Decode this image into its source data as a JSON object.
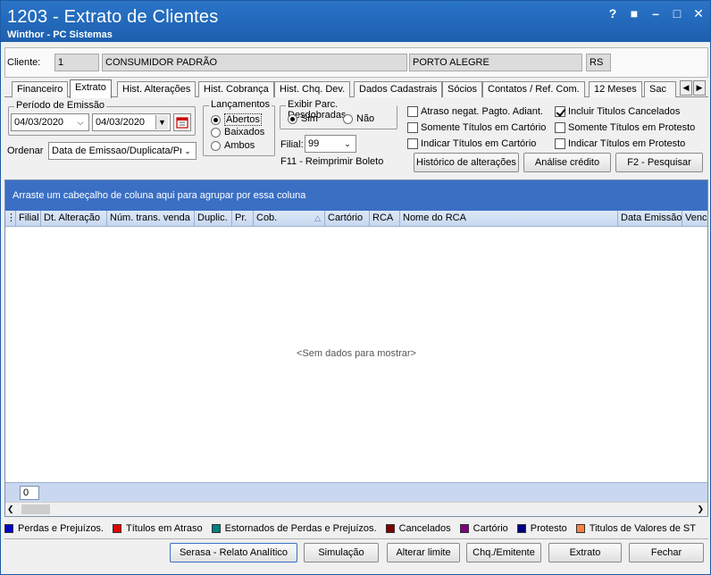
{
  "window": {
    "title": "1203 - Extrato de Clientes",
    "subtitle": "Winthor - PC Sistemas",
    "controls": [
      "?",
      "■",
      "–",
      "□",
      "✕"
    ]
  },
  "client": {
    "label": "Cliente:",
    "code": "1",
    "name": "CONSUMIDOR PADRÃO",
    "city": "PORTO ALEGRE",
    "state": "RS"
  },
  "tabs": [
    "Financeiro",
    "Extrato",
    "Hist. Alterações",
    "Hist. Cobrança",
    "Hist. Chq. Dev.",
    "Dados Cadastrais",
    "Sócios",
    "Contatos / Ref. Com.",
    "12 Meses",
    "Sac"
  ],
  "active_tab": "Extrato",
  "periodo": {
    "legend": "Período de Emissão",
    "start": "04/03/2020",
    "end": "04/03/2020"
  },
  "ordenar": {
    "label": "Ordenar",
    "value": "Data de Emissao/Duplicata/Pre"
  },
  "lancamentos": {
    "legend": "Lançamentos",
    "options": [
      "Abertos",
      "Baixados",
      "Ambos"
    ],
    "selected": "Abertos"
  },
  "exibir": {
    "legend": "Exibir Parc. Desdobradas",
    "options": [
      "Sim",
      "Não"
    ],
    "selected": "Sim"
  },
  "filial": {
    "label": "Filial:",
    "value": "99"
  },
  "f11": "F11 - Reimprimir Boleto",
  "checks": [
    {
      "label": "Atraso negat. Pagto. Adiant.",
      "checked": false
    },
    {
      "label": "Somente Títulos em Cartório",
      "checked": false
    },
    {
      "label": "Indicar Títulos em Cartório",
      "checked": false
    },
    {
      "label": "Incluir Titulos Cancelados",
      "checked": true
    },
    {
      "label": "Somente Títulos em Protesto",
      "checked": false
    },
    {
      "label": "Indicar Títulos em Protesto",
      "checked": false
    }
  ],
  "actions": {
    "historico": "Histórico de alterações",
    "analise": "Análise crédito",
    "pesquisar": "F2 - Pesquisar"
  },
  "grid": {
    "groupbar": "Arraste um cabeçalho de coluna aqui para agrupar por essa coluna",
    "columns": [
      "Filial",
      "Dt. Alteração",
      "Núm. trans. venda",
      "Duplic.",
      "Pr.",
      "Cob.",
      "Cartório",
      "RCA",
      "Nome do RCA",
      "Data Emissão",
      "Venc"
    ],
    "empty": "<Sem dados para mostrar>",
    "count": "0"
  },
  "legend": [
    {
      "label": "Perdas e Prejuízos.",
      "color": "#0000cc"
    },
    {
      "label": "Títulos em Atraso",
      "color": "#e00000"
    },
    {
      "label": "Estornados de Perdas e Prejuízos.",
      "color": "#008080"
    },
    {
      "label": "Cancelados",
      "color": "#800000"
    },
    {
      "label": "Cartório",
      "color": "#800080"
    },
    {
      "label": "Protesto",
      "color": "#000080"
    },
    {
      "label": "Titulos de Valores de ST",
      "color": "#ff8040"
    }
  ],
  "bottom_buttons": {
    "serasa": "Serasa - Relato Analítico",
    "simulacao": "Simulação",
    "alterar": "Alterar limite",
    "chq": "Chq./Emitente",
    "extrato": "Extrato",
    "fechar": "Fechar"
  }
}
